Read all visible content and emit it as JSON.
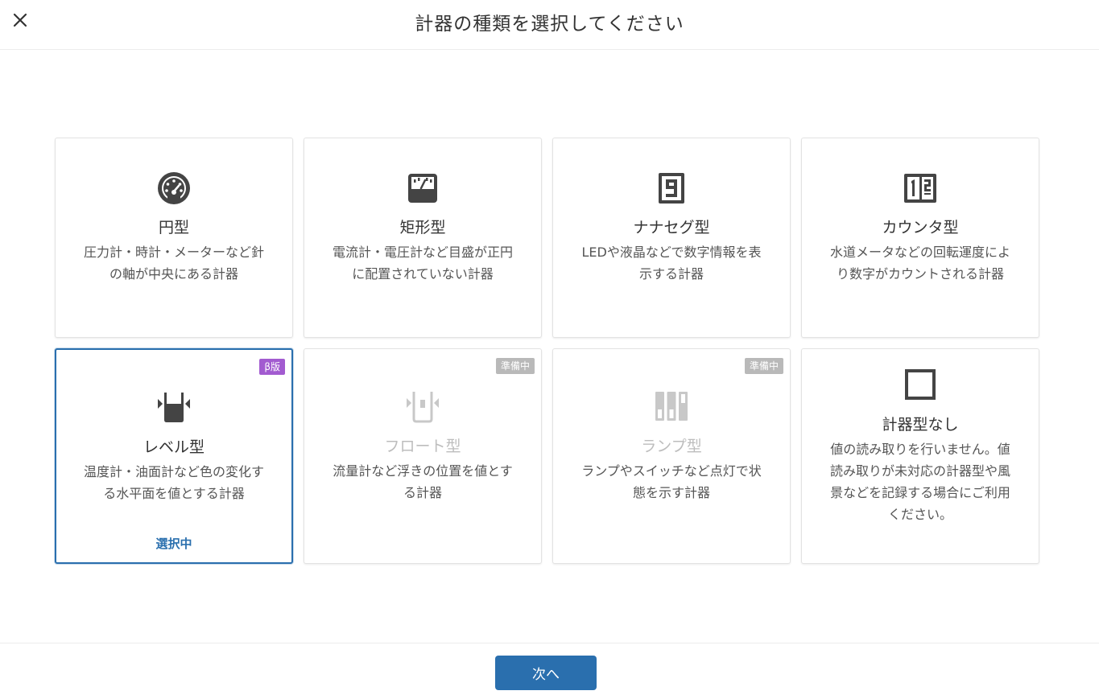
{
  "header": {
    "title": "計器の種類を選択してください",
    "close_icon": "close-icon"
  },
  "cards": [
    {
      "id": "circle",
      "icon": "gauge-icon",
      "title": "円型",
      "desc": [
        "圧力計・時計・メーターなど針",
        "の軸が中央にある計器"
      ],
      "state": "enabled"
    },
    {
      "id": "rect",
      "icon": "rect-meter-icon",
      "title": "矩形型",
      "desc": [
        "電流計・電圧計など目盛が正円",
        "に配置されていない計器"
      ],
      "state": "enabled"
    },
    {
      "id": "seven-seg",
      "icon": "seven-segment-icon",
      "title": "ナナセグ型",
      "desc": [
        "LEDや液晶などで数字情報を表",
        "示する計器"
      ],
      "state": "enabled"
    },
    {
      "id": "counter",
      "icon": "counter-icon",
      "title": "カウンタ型",
      "desc": [
        "水道メータなどの回転運度によ",
        "り数字がカウントされる計器"
      ],
      "state": "enabled"
    },
    {
      "id": "level",
      "icon": "level-icon",
      "title": "レベル型",
      "desc": [
        "温度計・油面計など色の変化す",
        "る水平面を値とする計器"
      ],
      "state": "selected",
      "badge": "β版",
      "selected_label": "選択中"
    },
    {
      "id": "float",
      "icon": "float-icon",
      "title": "フロート型",
      "desc": [
        "流量計など浮きの位置を値とす",
        "る計器"
      ],
      "state": "disabled",
      "badge": "準備中"
    },
    {
      "id": "lamp",
      "icon": "lamp-icon",
      "title": "ランプ型",
      "desc": [
        "ランプやスイッチなど点灯で状",
        "態を示す計器"
      ],
      "state": "disabled",
      "badge": "準備中"
    },
    {
      "id": "none",
      "icon": "empty-square-icon",
      "title": "計器型なし",
      "desc": [
        "値の読み取りを行いません。値",
        "読み取りが未対応の計器型や風",
        "景などを記録する場合にご利用",
        "ください。"
      ],
      "state": "enabled"
    }
  ],
  "footer": {
    "next_label": "次へ"
  },
  "colors": {
    "primary": "#2a6fae",
    "beta_badge": "#a25bd0",
    "prep_badge": "#b9b9b9",
    "icon_dark": "#444444",
    "icon_disabled": "#c8c8c8"
  }
}
